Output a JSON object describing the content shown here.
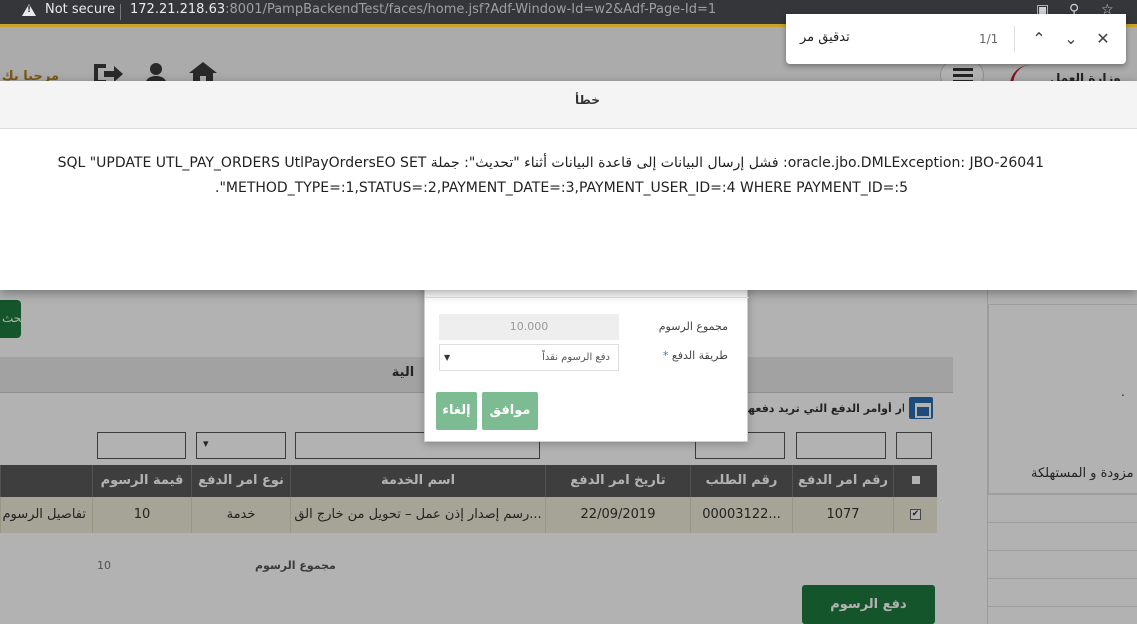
{
  "browser": {
    "not_secure": "Not secure",
    "url_host": "172.21.218.63",
    "url_path": ":8001/PampBackendTest/faces/home.jsf?Adf-Window-Id=w2&Adf-Page-Id=1"
  },
  "find_bar": {
    "query": "تدقيق مر",
    "count": "1/1"
  },
  "header": {
    "welcome": "مرحبا بك",
    "logo_text": "وزارة العمل"
  },
  "error_dialog": {
    "title": "خطأ",
    "message_line1": "oracle.jbo.DMLException: JBO-26041: فشل إرسال البيانات إلى قاعدة البيانات أثناء \"تحديث\": جملة SQL \"UPDATE UTL_PAY_ORDERS UtlPayOrdersEO SET",
    "message_line2": "METHOD_TYPE=:1,STATUS=:2,PAYMENT_DATE=:3,PAYMENT_USER_ID=:4 WHERE PAYMENT_ID=:5\"."
  },
  "payment_dialog": {
    "total_label": "مجموع الرسوم",
    "total_value": "10.000",
    "method_label": "طريقة الدفع",
    "required_mark": "*",
    "method_value": "دفع الرسوم نقداً",
    "ok_label": "موافق",
    "cancel_label": "إلغاء"
  },
  "left_button_label": "بحث",
  "section": {
    "title": "الية",
    "hint": "الرجاء إختيار أوامر الدفع التي تريد دفعها"
  },
  "right_panel": {
    "label": "مزودة و المستهلكة",
    "dot": "."
  },
  "table": {
    "columns": [
      "رقم امر الدفع",
      "رقم الطلب",
      "تاريخ امر الدفع",
      "اسم الخدمة",
      "نوع امر الدفع",
      "قيمة الرسوم"
    ],
    "filter_select": "▾",
    "row": {
      "checked": "✔",
      "order_no": "1077",
      "request_no": "00003122...",
      "date": "22/09/2019",
      "service": "رسم إصدار إذن عمل – تحويل من خارج الق...",
      "type": "خدمة",
      "amount": "10",
      "details": "تفاصيل الرسوم"
    }
  },
  "summary": {
    "label": "مجموع الرسوم",
    "value": "10"
  },
  "pay_button": "دفع الرسوم"
}
